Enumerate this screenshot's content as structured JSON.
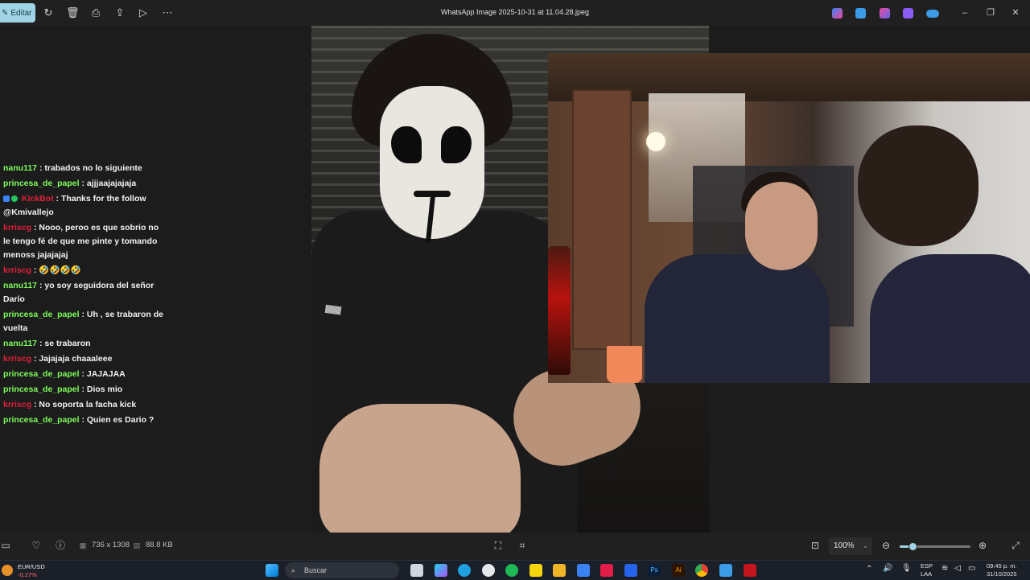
{
  "toolbar": {
    "edit_label": "Editar",
    "title": "WhatsApp Image 2025-10-31 at 11.04.28.jpeg"
  },
  "chat": [
    {
      "user": "nanu117",
      "text": ": trabados no lo siguiente",
      "color": "green"
    },
    {
      "user": "princesa_de_papel",
      "text": ": ajjjaajajajaja",
      "color": "green"
    },
    {
      "user": "KickBot",
      "text": ": Thanks for the follow @Kmivallejo",
      "color": "red",
      "badges": true
    },
    {
      "user": "krriscg",
      "text": ": Nooo, peroo es que sobrio no le tengo fé de que me pinte y tomando menoss jajajajaj",
      "color": "red"
    },
    {
      "user": "krriscg",
      "text": ": 🤣🤣🤣🤣",
      "color": "red"
    },
    {
      "user": "nanu117",
      "text": ": yo soy seguidora del señor Darío",
      "color": "green"
    },
    {
      "user": "princesa_de_papel",
      "text": ": Uh , se trabaron de vuelta",
      "color": "green"
    },
    {
      "user": "nanu117",
      "text": ": se trabaron",
      "color": "green"
    },
    {
      "user": "krriscg",
      "text": ": Jajajaja chaaaleee",
      "color": "red"
    },
    {
      "user": "princesa_de_papel",
      "text": ": JAJAJAA",
      "color": "green"
    },
    {
      "user": "princesa_de_papel",
      "text": ": Dios mio",
      "color": "green"
    },
    {
      "user": "krriscg",
      "text": ": No soporta la facha kick",
      "color": "red"
    },
    {
      "user": "princesa_de_papel",
      "text": ": Quien es Dario ?",
      "color": "green"
    }
  ],
  "status": {
    "dimensions": "736 x 1308",
    "size": "88.8 KB",
    "zoom": "100%",
    "zoom_level": 0.1
  },
  "taskbar": {
    "stock_symbol": "EUR/USD",
    "stock_change": "-0,27%",
    "search_placeholder": "Buscar",
    "lang": "ESP",
    "lang_sub": "LAA",
    "time": "09:45 p. m.",
    "date": "31/10/2025"
  },
  "colors": {
    "accent": "#9fd5e6",
    "chat_green": "#7dfc5a",
    "chat_red": "#e0203a"
  }
}
